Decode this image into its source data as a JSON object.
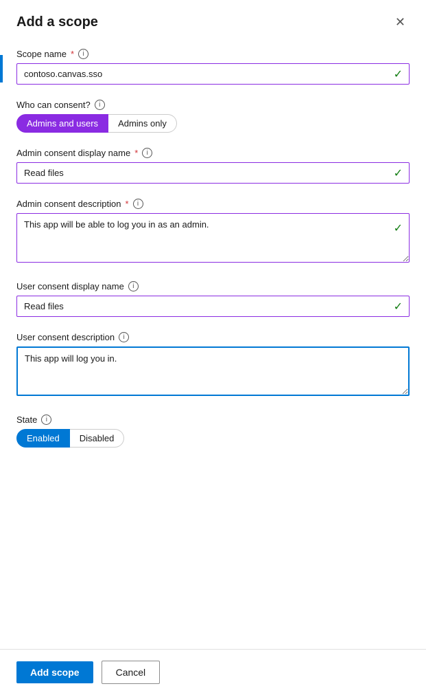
{
  "dialog": {
    "title": "Add a scope",
    "close_label": "✕"
  },
  "form": {
    "scope_name_label": "Scope name",
    "scope_name_value": "contoso.canvas.sso",
    "who_can_consent_label": "Who can consent?",
    "consent_option_admins_users": "Admins and users",
    "consent_option_admins_only": "Admins only",
    "admin_consent_display_name_label": "Admin consent display name",
    "admin_consent_display_name_value": "Read files",
    "admin_consent_description_label": "Admin consent description",
    "admin_consent_description_value": "This app will be able to log you in as an admin.",
    "user_consent_display_name_label": "User consent display name",
    "user_consent_display_name_value": "Read files",
    "user_consent_description_label": "User consent description",
    "user_consent_description_value": "This app will log you in.",
    "state_label": "State",
    "state_option_enabled": "Enabled",
    "state_option_disabled": "Disabled"
  },
  "footer": {
    "add_scope_label": "Add scope",
    "cancel_label": "Cancel"
  },
  "icons": {
    "info": "i",
    "check": "✓",
    "close": "✕"
  }
}
